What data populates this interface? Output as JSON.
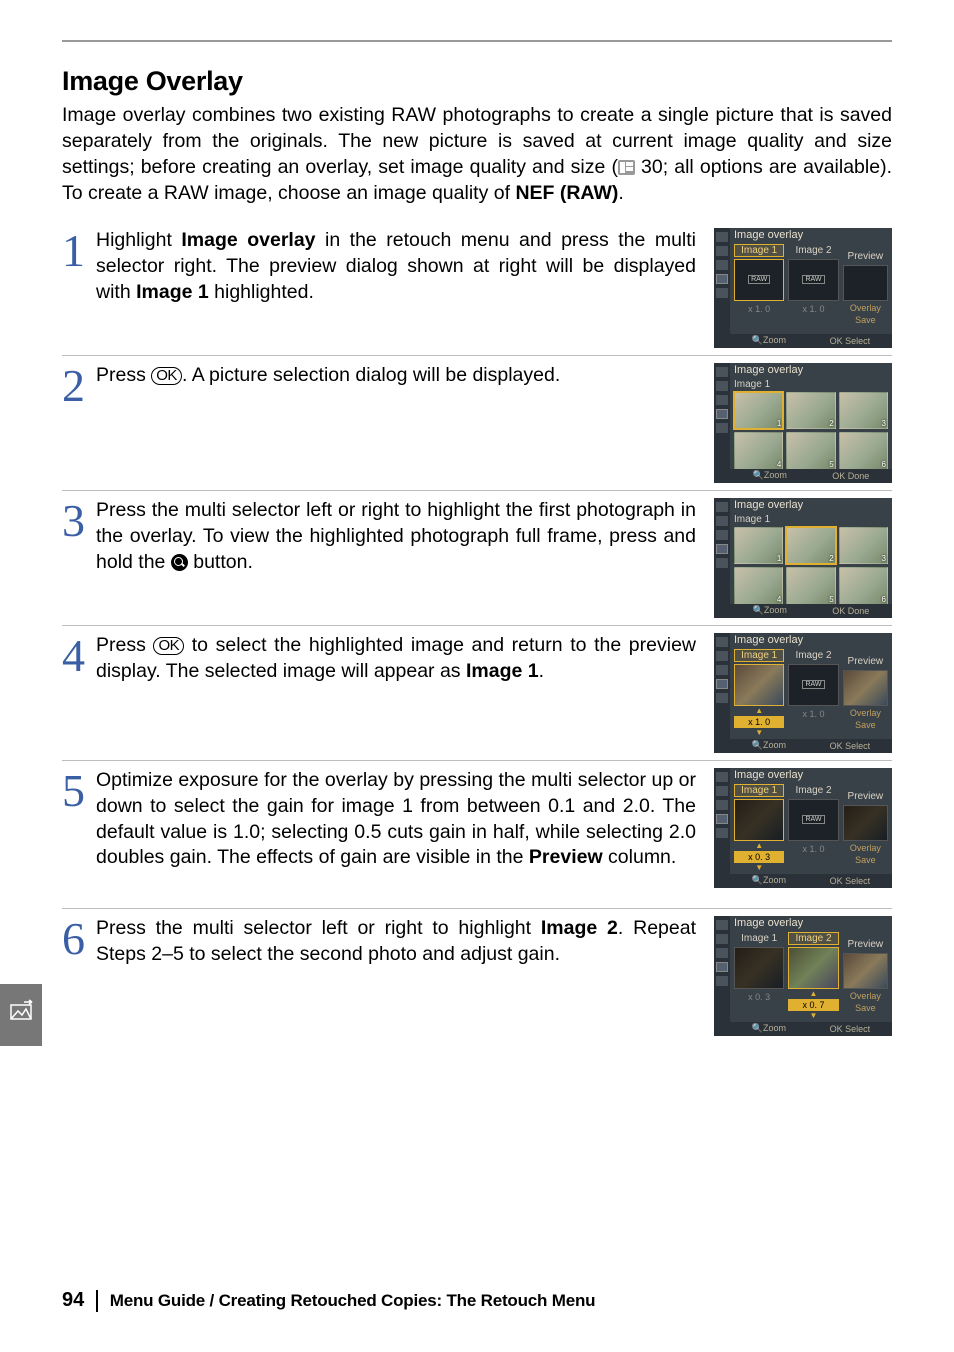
{
  "section_title": "Image Overlay",
  "intro_parts": {
    "p1": "Image overlay combines two existing RAW photographs to create a single picture that is saved separately from the originals.  The new picture is saved at current image quality and size settings; before creating an overlay, set image quality and size (",
    "ref": " 30; all options are available).  To create a RAW image, choose an image quality of ",
    "nef": "NEF (RAW)",
    "end": "."
  },
  "steps": [
    {
      "num": "1",
      "html": "Highlight <b>Image overlay</b> in the retouch menu and press the multi selector right.  The preview dialog shown at right will be displayed with <b>Image 1</b> highlighted."
    },
    {
      "num": "2",
      "html": "Press <span class='ok-btn'>OK</span>.  A picture selection dialog will be displayed."
    },
    {
      "num": "3",
      "html": "Press the multi selector left or right to highlight the first photograph in the overlay.  To view the highlighted photograph full frame, press and hold the <span class='zoom-btn' data-name='zoom-in-icon'></span> button."
    },
    {
      "num": "4",
      "html": "Press <span class='ok-btn'>OK</span> to select the highlighted image and return to the preview display.  The selected image will appear as <b>Image 1</b>."
    },
    {
      "num": "5",
      "html": "Optimize exposure for the overlay by pressing the multi selector up or down to select the gain for image 1 from between 0.1 and 2.0.  The default value is 1.0; selecting 0.5 cuts gain in half, while selecting 2.0 doubles gain.  The effects of gain are visible in the <b>Preview</b> column."
    },
    {
      "num": "6",
      "html": "Press the multi selector left or right to highlight <b>Image 2</b>.  Repeat Steps 2–5 to select the second photo and adjust gain."
    }
  ],
  "screens": {
    "overlay_title": "Image overlay",
    "image1": "Image 1",
    "image2": "Image 2",
    "preview": "Preview",
    "raw": "RAW",
    "overlay": "Overlay",
    "save": "Save",
    "zoom": "Zoom",
    "ok_select": "OK Select",
    "ok_done": "OK Done",
    "gain10": "x 1. 0",
    "gain03": "x 0. 3",
    "gain07": "x 0. 7"
  },
  "footer": {
    "page": "94",
    "text": "Menu Guide / Creating Retouched Copies: The Retouch Menu"
  }
}
